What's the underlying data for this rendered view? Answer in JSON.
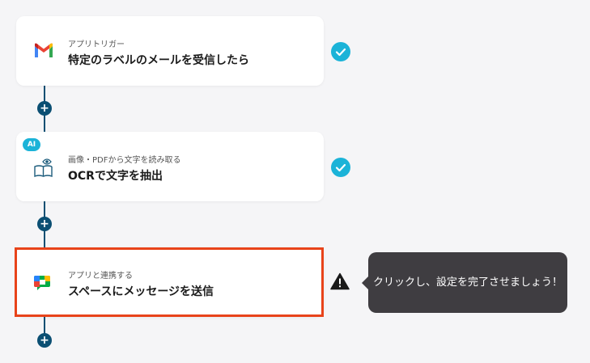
{
  "steps": [
    {
      "subtitle": "アプリトリガー",
      "title": "特定のラベルのメールを受信したら",
      "icon": "gmail-icon",
      "status": "complete"
    },
    {
      "badge": "AI",
      "subtitle": "画像・PDFから文字を読み取る",
      "title": "OCRで文字を抽出",
      "icon": "book-eye-icon",
      "status": "complete"
    },
    {
      "subtitle": "アプリと連携する",
      "title": "スペースにメッセージを送信",
      "icon": "google-chat-icon",
      "status": "incomplete"
    }
  ],
  "add_button_label": "+",
  "tooltip": {
    "text": "クリックし、設定を完了させましょう！"
  },
  "colors": {
    "connector": "#0b4f73",
    "check": "#1bb3d8",
    "highlight": "#e8431a",
    "tooltip_bg": "#3f3d41"
  }
}
